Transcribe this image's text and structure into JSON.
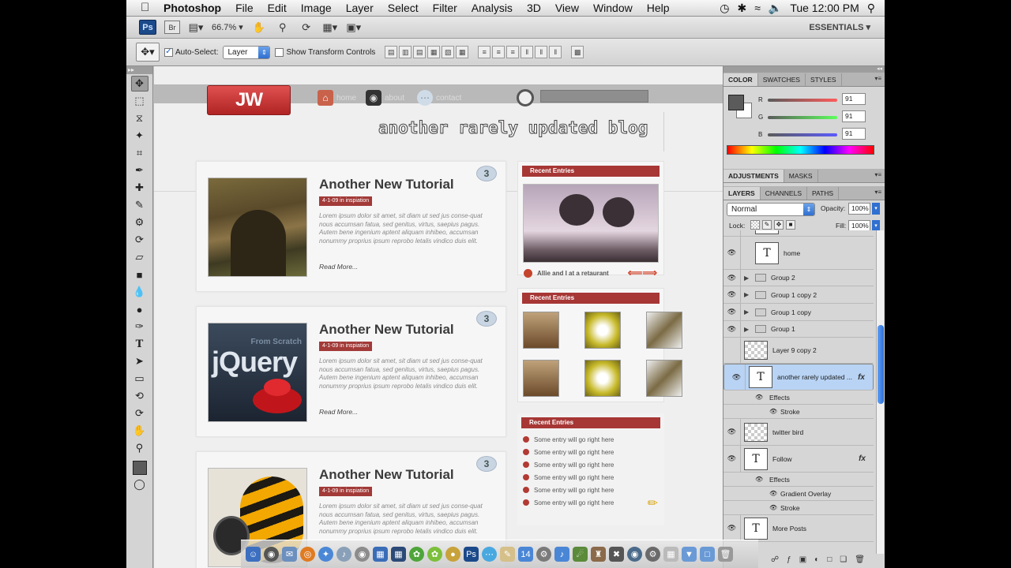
{
  "menubar": {
    "app_name": "Photoshop",
    "items": [
      "File",
      "Edit",
      "Image",
      "Layer",
      "Select",
      "Filter",
      "Analysis",
      "3D",
      "View",
      "Window",
      "Help"
    ],
    "clock": "Tue 12:00 PM"
  },
  "appbar": {
    "ps_badge": "Ps",
    "br_badge": "Br",
    "zoom": "66.7%",
    "workspace": "ESSENTIALS"
  },
  "options": {
    "auto_select_label": "Auto-Select:",
    "auto_select_value": "Layer",
    "show_transform_label": "Show Transform Controls"
  },
  "canvas": {
    "logo": "JW",
    "nav": [
      "home",
      "about",
      "contact"
    ],
    "tagline": "another rarely updated blog",
    "posts": [
      {
        "title": "Another New Tutorial",
        "date": "4-1-09 in inspiation",
        "body": "Lorem ipsum dolor sit amet, sit diam ut sed jus conse-quat nous accumsan fatua, sed genitus, virtus, saepius pagus. Autem bene ingenium aptent aliquam inhibeo, accumsan nonummy proprius ipsum reprobo letalis vindico duis elit.",
        "more": "Read More...",
        "comments": "3"
      },
      {
        "title": "Another New Tutorial",
        "date": "4-1-09 in inspiation",
        "body": "Lorem ipsum dolor sit amet, sit diam ut sed jus conse-quat nous accumsan fatua, sed genitus, virtus, saepius pagus. Autem bene ingenium aptent aliquam inhibeo, accumsan nonummy proprius ipsum reprobo letalis vindico duis elit.",
        "more": "Read More...",
        "comments": "3",
        "thumb_text_a": "From Scratch",
        "thumb_text_b": "jQuery"
      },
      {
        "title": "Another New Tutorial",
        "date": "4-1-09 in inspiation",
        "body": "Lorem ipsum dolor sit amet, sit diam ut sed jus conse-quat nous accumsan fatua, sed genitus, virtus, saepius pagus. Autem bene ingenium aptent aliquam inhibeo, accumsan nonummy proprius ipsum reprobo letalis vindico duis elit.",
        "more": "",
        "comments": "3"
      }
    ],
    "sidebar": {
      "box1_title": "Recent Entries",
      "box1_caption": "Allie and I at a retaurant",
      "box2_title": "Recent Entries",
      "box3_title": "Recent Entries",
      "entries": [
        "Some entry will go right here",
        "Some entry will go right here",
        "Some entry will go right here",
        "Some entry will go right here",
        "Some entry will go right here",
        "Some entry will go right here"
      ]
    }
  },
  "color_panel": {
    "tabs": [
      "COLOR",
      "SWATCHES",
      "STYLES"
    ],
    "r_label": "R",
    "g_label": "G",
    "b_label": "B",
    "r": "91",
    "g": "91",
    "b": "91"
  },
  "adjust_panel": {
    "tabs": [
      "ADJUSTMENTS",
      "MASKS"
    ]
  },
  "layers_panel": {
    "tabs": [
      "LAYERS",
      "CHANNELS",
      "PATHS"
    ],
    "blend_mode": "Normal",
    "opacity_label": "Opacity:",
    "opacity": "100%",
    "lock_label": "Lock:",
    "fill_label": "Fill:",
    "fill": "100%",
    "layers": {
      "home": "home",
      "group2": "Group 2",
      "group1copy2": "Group 1 copy 2",
      "group1copy": "Group 1 copy",
      "group1": "Group 1",
      "layer9copy2": "Layer 9 copy 2",
      "blogtitle": "another rarely updated ...",
      "effects1": "Effects",
      "stroke1": "Stroke",
      "twitter": "twitter bird",
      "follow": "Follow",
      "effects2": "Effects",
      "gradient": "Gradient Overlay",
      "stroke2": "Stroke",
      "moreposts": "More Posts"
    }
  },
  "colors": {
    "accent_red": "#a63735",
    "selection_blue": "#b8d3f4"
  }
}
